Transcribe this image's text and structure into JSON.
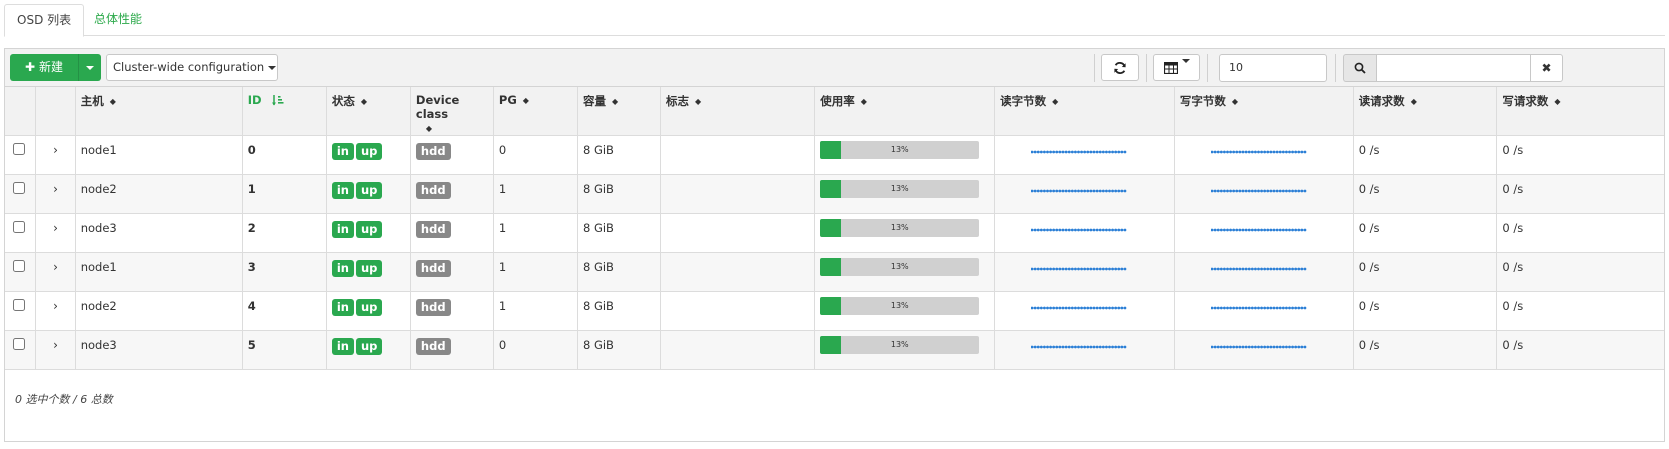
{
  "tabs": [
    {
      "label": "OSD 列表",
      "active": true
    },
    {
      "label": "总体性能",
      "active": false
    }
  ],
  "toolbar": {
    "new_label": "新建",
    "config_label": "Cluster-wide configuration",
    "page_size": "10",
    "search_value": ""
  },
  "columns": [
    "",
    "",
    "主机",
    "ID",
    "状态",
    "Device class",
    "PG",
    "容量",
    "标志",
    "使用率",
    "读字节数",
    "写字节数",
    "读请求数",
    "写请求数"
  ],
  "rows": [
    {
      "host": "node1",
      "id": "0",
      "status": [
        "in",
        "up"
      ],
      "device_class": "hdd",
      "pg": "0",
      "size": "8 GiB",
      "flags": "",
      "usage": "13%",
      "usage_fraction": 0.13,
      "read_ops": "0 /s",
      "write_ops": "0 /s"
    },
    {
      "host": "node2",
      "id": "1",
      "status": [
        "in",
        "up"
      ],
      "device_class": "hdd",
      "pg": "1",
      "size": "8 GiB",
      "flags": "",
      "usage": "13%",
      "usage_fraction": 0.13,
      "read_ops": "0 /s",
      "write_ops": "0 /s"
    },
    {
      "host": "node3",
      "id": "2",
      "status": [
        "in",
        "up"
      ],
      "device_class": "hdd",
      "pg": "1",
      "size": "8 GiB",
      "flags": "",
      "usage": "13%",
      "usage_fraction": 0.13,
      "read_ops": "0 /s",
      "write_ops": "0 /s"
    },
    {
      "host": "node1",
      "id": "3",
      "status": [
        "in",
        "up"
      ],
      "device_class": "hdd",
      "pg": "1",
      "size": "8 GiB",
      "flags": "",
      "usage": "13%",
      "usage_fraction": 0.13,
      "read_ops": "0 /s",
      "write_ops": "0 /s"
    },
    {
      "host": "node2",
      "id": "4",
      "status": [
        "in",
        "up"
      ],
      "device_class": "hdd",
      "pg": "1",
      "size": "8 GiB",
      "flags": "",
      "usage": "13%",
      "usage_fraction": 0.13,
      "read_ops": "0 /s",
      "write_ops": "0 /s"
    },
    {
      "host": "node3",
      "id": "5",
      "status": [
        "in",
        "up"
      ],
      "device_class": "hdd",
      "pg": "0",
      "size": "8 GiB",
      "flags": "",
      "usage": "13%",
      "usage_fraction": 0.13,
      "read_ops": "0 /s",
      "write_ops": "0 /s"
    }
  ],
  "footer": {
    "summary": "0 选中个数 / 6 总数"
  },
  "colors": {
    "accent": "#2aa84f",
    "badge_grey": "#888888",
    "sparkline": "#2b7fd6",
    "progress_track": "#d0d0d0"
  },
  "icons": {
    "new": "plus-icon",
    "refresh": "refresh-icon",
    "columns": "table-columns-icon",
    "search": "search-icon",
    "clear": "close-icon",
    "sort": "sort-icon",
    "expand": "chevron-right-icon"
  }
}
